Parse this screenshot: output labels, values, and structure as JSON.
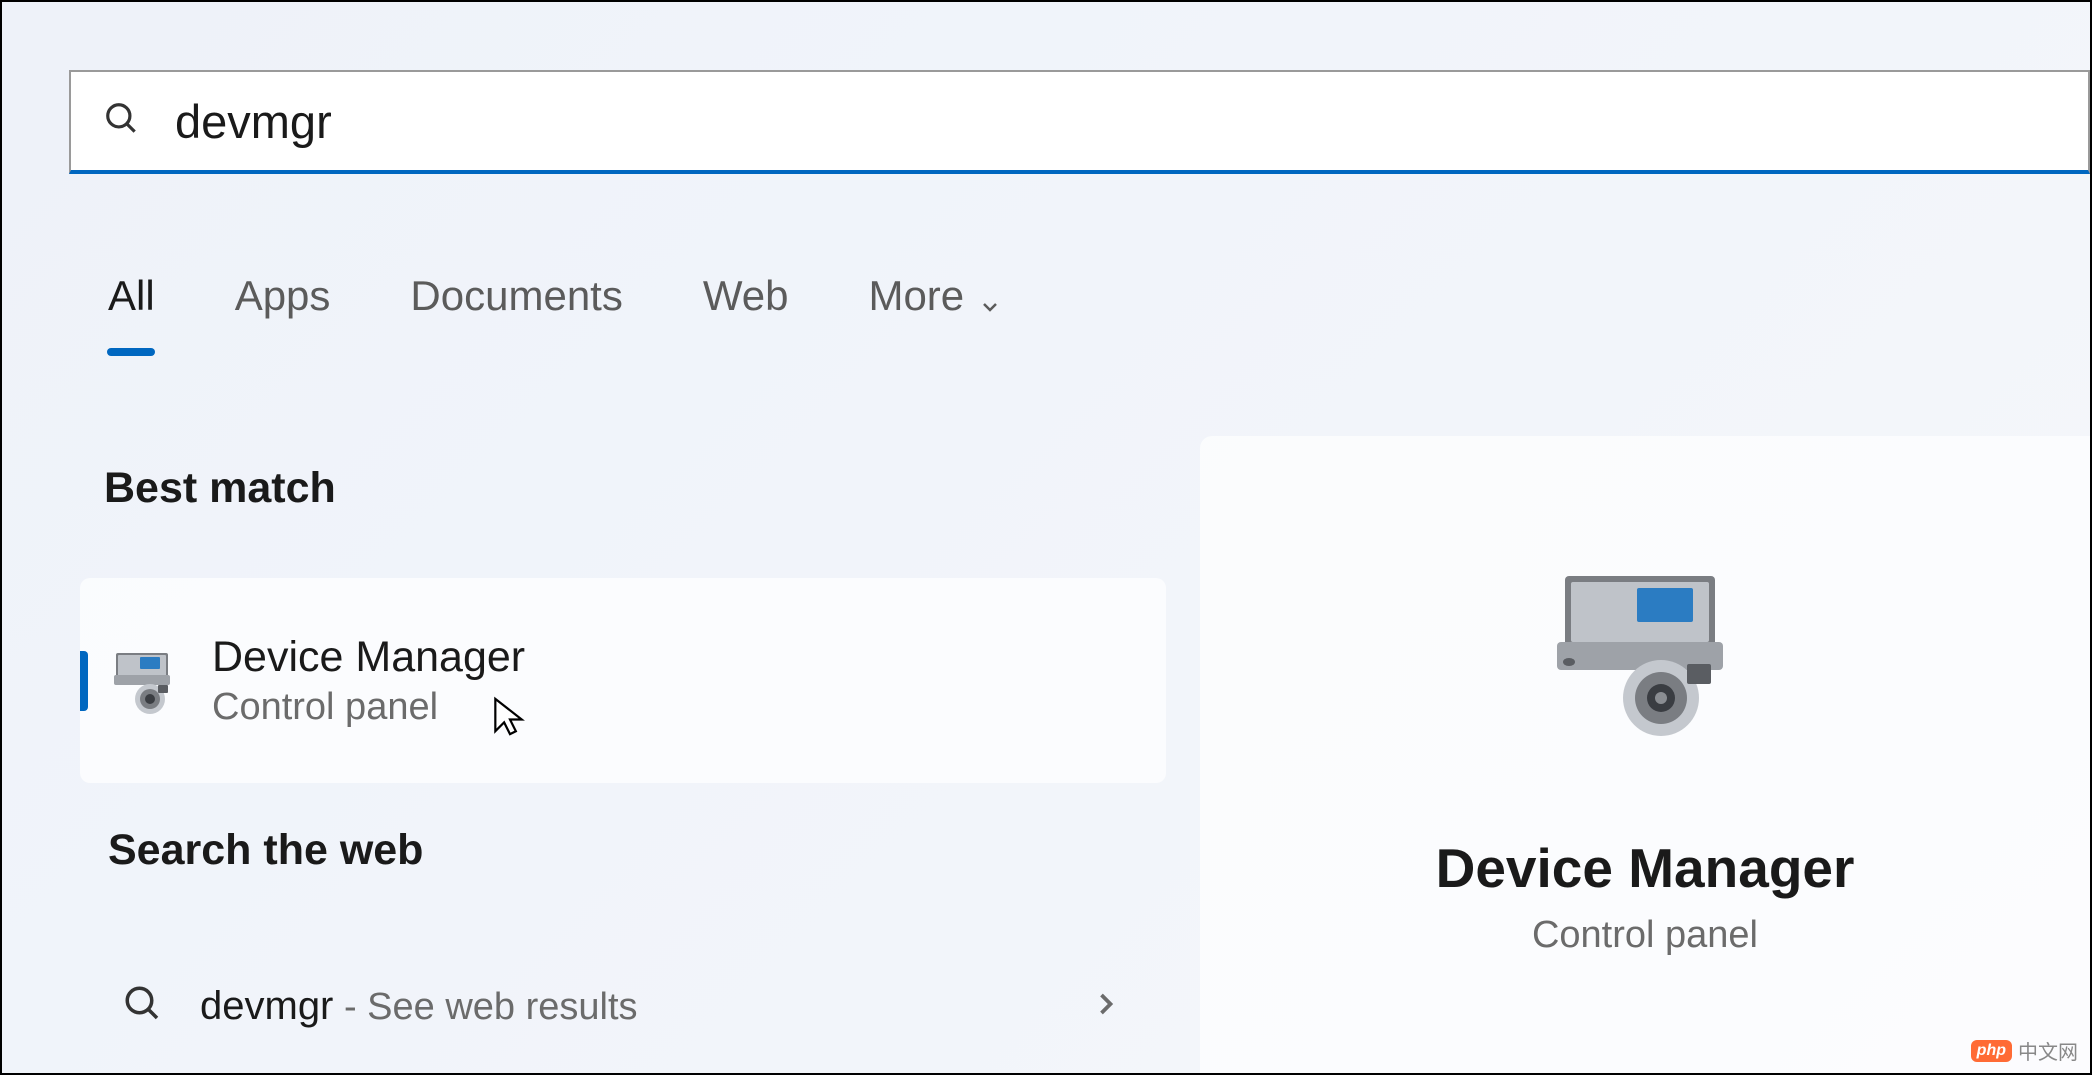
{
  "search": {
    "query": "devmgr"
  },
  "tabs": {
    "all": "All",
    "apps": "Apps",
    "documents": "Documents",
    "web": "Web",
    "more": "More"
  },
  "sections": {
    "best_match": "Best match",
    "search_web": "Search the web"
  },
  "best_match_result": {
    "title": "Device Manager",
    "subtitle": "Control panel"
  },
  "web_result": {
    "query": "devmgr",
    "suffix": " - See web results"
  },
  "preview": {
    "title": "Device Manager",
    "subtitle": "Control panel"
  },
  "watermark": {
    "badge": "php",
    "text": "中文网"
  },
  "colors": {
    "accent": "#0067c0"
  }
}
